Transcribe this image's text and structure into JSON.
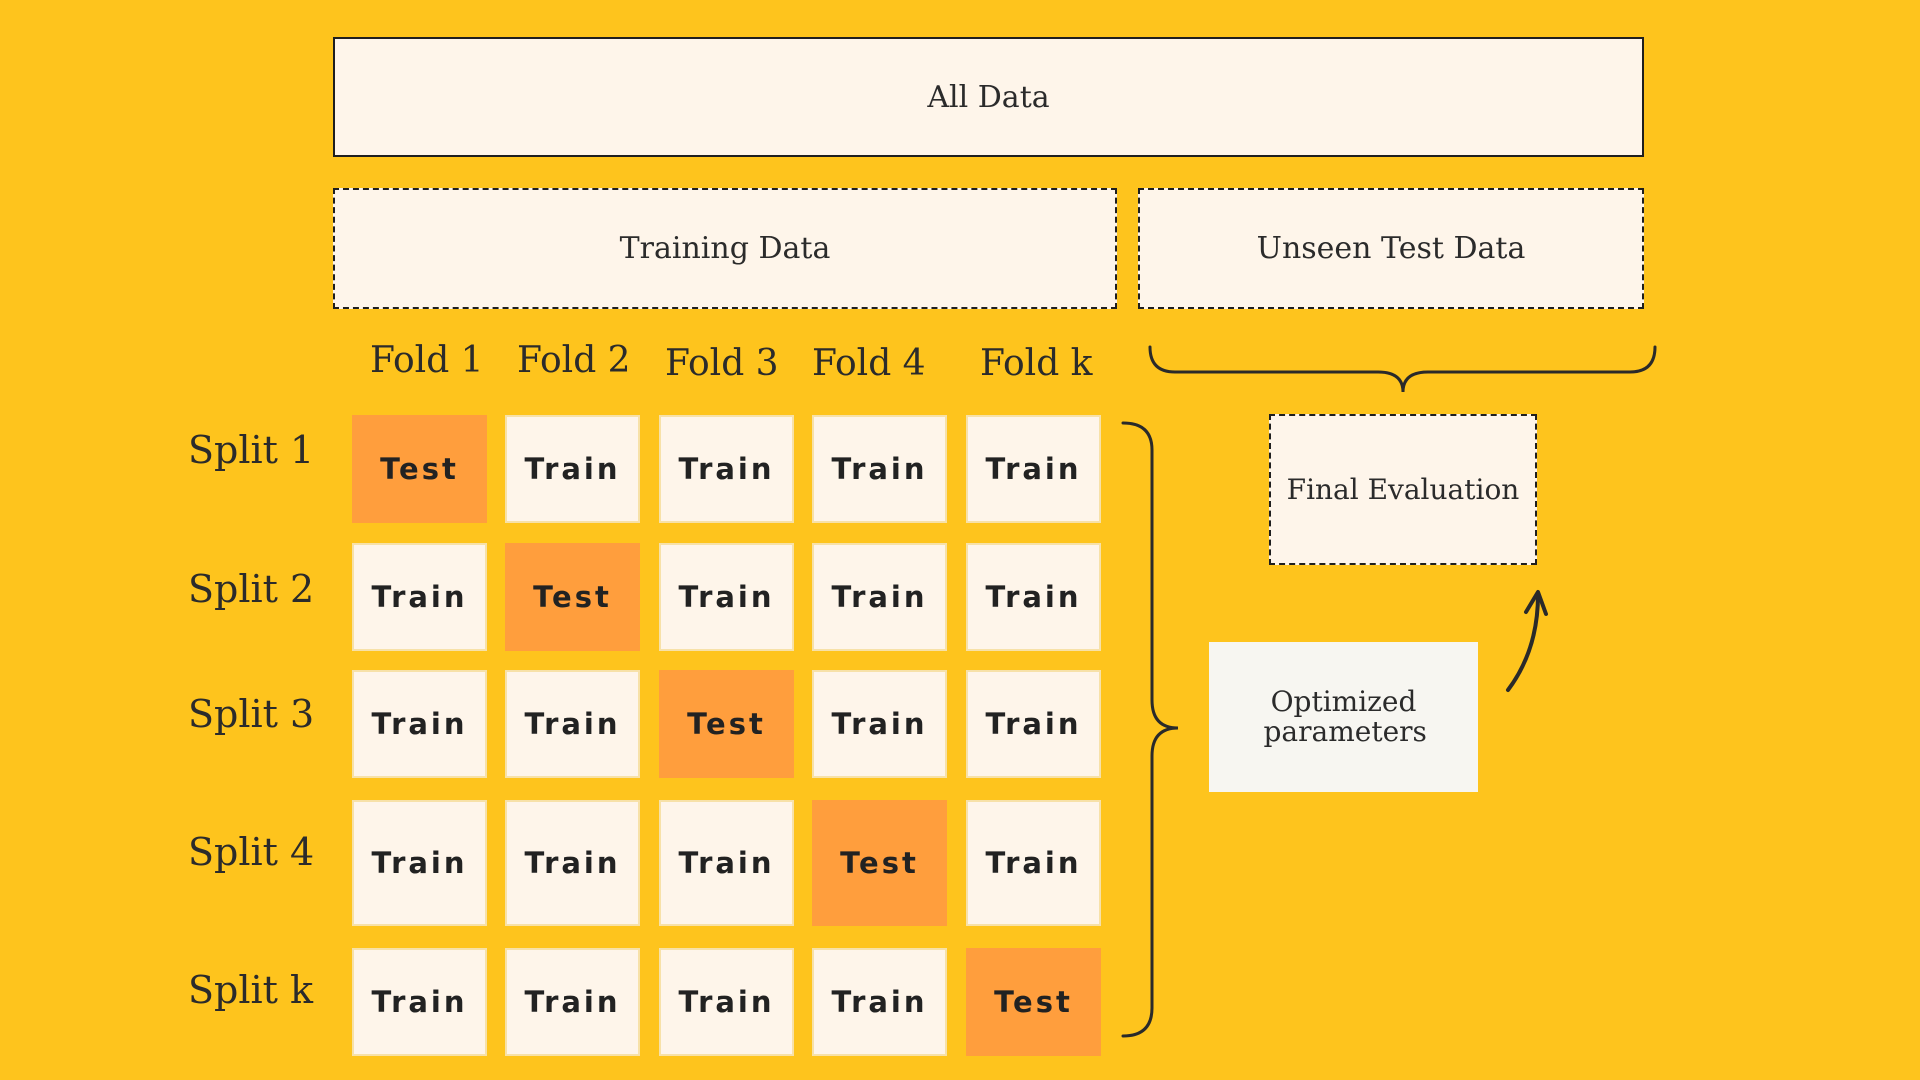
{
  "all_data": "All Data",
  "training_data": "Training Data",
  "unseen_test_data": "Unseen Test Data",
  "folds": [
    "Fold 1",
    "Fold 2",
    "Fold 3",
    "Fold 4",
    "Fold k"
  ],
  "splits": [
    {
      "label": "Split 1",
      "cells": [
        "Test",
        "Train",
        "Train",
        "Train",
        "Train"
      ]
    },
    {
      "label": "Split 2",
      "cells": [
        "Train",
        "Test",
        "Train",
        "Train",
        "Train"
      ]
    },
    {
      "label": "Split 3",
      "cells": [
        "Train",
        "Train",
        "Test",
        "Train",
        "Train"
      ]
    },
    {
      "label": "Split 4",
      "cells": [
        "Train",
        "Train",
        "Train",
        "Test",
        "Train"
      ]
    },
    {
      "label": "Split k",
      "cells": [
        "Train",
        "Train",
        "Train",
        "Train",
        "Test"
      ]
    }
  ],
  "final_evaluation": "Final Evaluation",
  "optimized_parameters": "Optimized parameters",
  "colors": {
    "background": "#FEC41D",
    "box_fill": "#FEF5EA",
    "test_fill": "#FF9E3D",
    "optimized_fill": "#F7F6F1"
  }
}
